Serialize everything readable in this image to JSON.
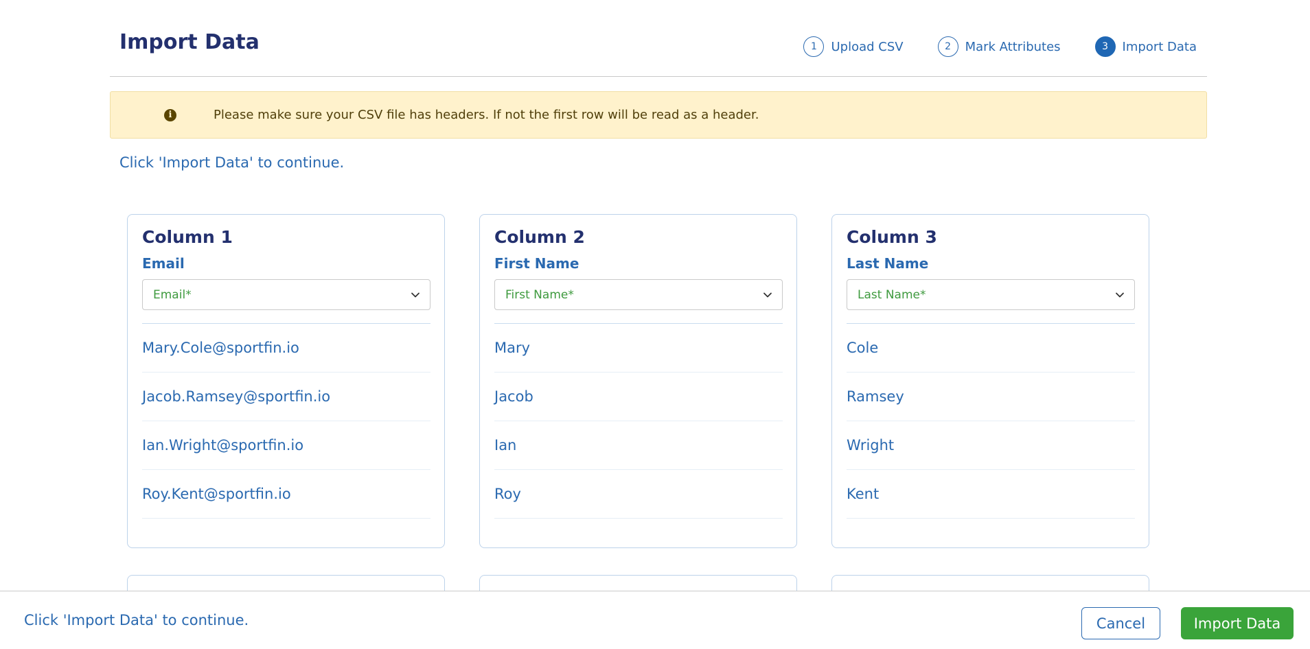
{
  "header": {
    "title": "Import Data",
    "steps": [
      {
        "number": "1",
        "label": "Upload CSV",
        "active": false
      },
      {
        "number": "2",
        "label": "Mark Attributes",
        "active": false
      },
      {
        "number": "3",
        "label": "Import Data",
        "active": true
      }
    ]
  },
  "alert": {
    "icon": "info-circle-icon",
    "text": "Please make sure your CSV file has headers. If not the first row will be read as a header."
  },
  "instruction": "Click 'Import Data' to continue.",
  "columns": [
    {
      "title": "Column 1",
      "attribute": "Email",
      "selected": "Email*",
      "rows": [
        "Mary.Cole@sportfin.io",
        "Jacob.Ramsey@sportfin.io",
        "Ian.Wright@sportfin.io",
        "Roy.Kent@sportfin.io"
      ]
    },
    {
      "title": "Column 2",
      "attribute": "First Name",
      "selected": "First Name*",
      "rows": [
        "Mary",
        "Jacob",
        "Ian",
        "Roy"
      ]
    },
    {
      "title": "Column 3",
      "attribute": "Last Name",
      "selected": "Last Name*",
      "rows": [
        "Cole",
        "Ramsey",
        "Wright",
        "Kent"
      ]
    }
  ],
  "footer": {
    "instruction": "Click 'Import Data' to continue.",
    "cancel_label": "Cancel",
    "import_label": "Import Data"
  },
  "colors": {
    "title": "#23306e",
    "text": "#2a69b0",
    "success": "#3aa43a",
    "alert_bg": "#fff2cc"
  }
}
